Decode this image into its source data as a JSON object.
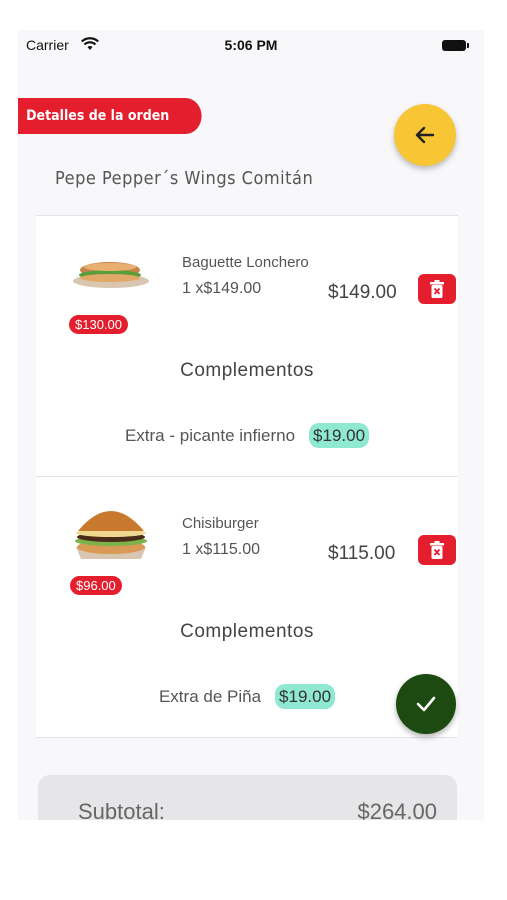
{
  "status_bar": {
    "carrier": "Carrier",
    "time": "5:06 PM"
  },
  "header": {
    "title": "Detalles de la orden",
    "back_icon": "arrow-left-icon"
  },
  "restaurant": {
    "name": "Pepe Pepper´s Wings Comitán"
  },
  "items": [
    {
      "name": "Baguette Lonchero",
      "quantity_line": "1 x$149.00",
      "total": "$149.00",
      "base_price": "$130.00",
      "image": "baguette-sandwich-image",
      "complements_title": "Complementos",
      "complement_name": "Extra - picante infierno",
      "complement_price": "$19.00"
    },
    {
      "name": "Chisiburger",
      "quantity_line": "1 x$115.00",
      "total": "$115.00",
      "base_price": "$96.00",
      "image": "burger-image",
      "complements_title": "Complementos",
      "complement_name": "Extra de Piña",
      "complement_price": "$19.00"
    }
  ],
  "summary": {
    "subtotal_label": "Subtotal:",
    "subtotal_value": "$264.00"
  },
  "colors": {
    "red": "#e41e2d",
    "yellow": "#f8c534",
    "green": "#1d4a10",
    "teal": "#8fe8d2"
  }
}
